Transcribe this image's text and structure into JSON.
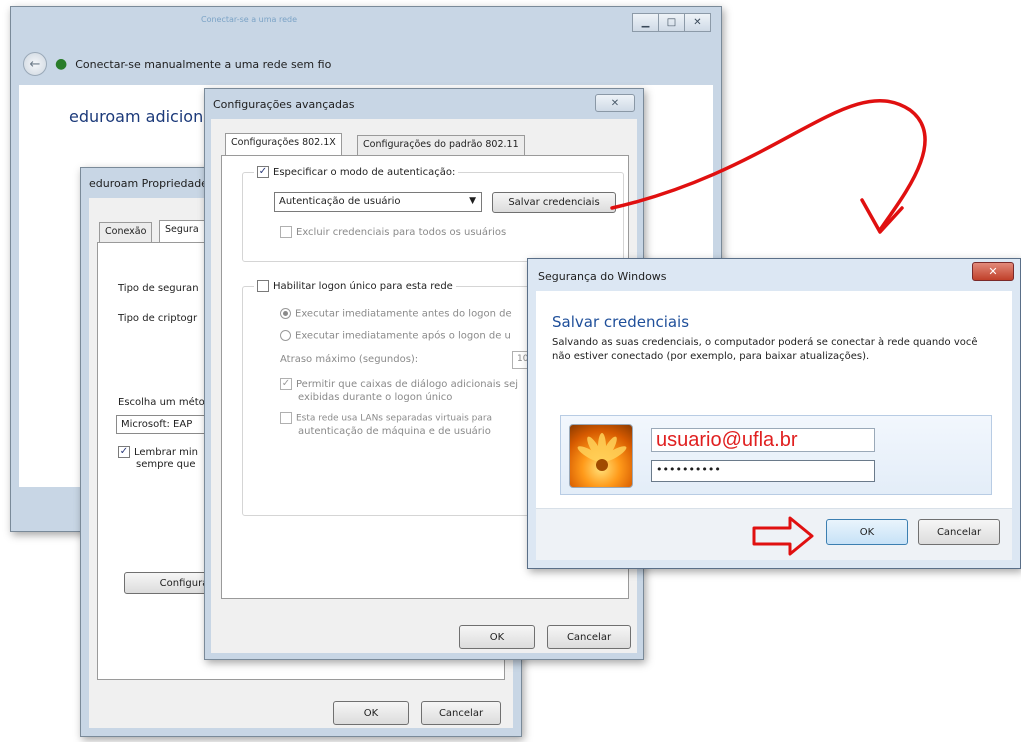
{
  "w1": {
    "title": "Conectar-se a uma rede",
    "nav_title": "Conectar-se manualmente a uma rede sem fio",
    "heading": "eduroam adiciona"
  },
  "w2": {
    "title": "eduroam Propriedades",
    "tabs": [
      "Conexão",
      "Segura"
    ],
    "labels": {
      "security_type": "Tipo de seguran",
      "encryption_type": "Tipo de criptogr",
      "choose_method": "Escolha um méto",
      "method_value": "Microsoft: EAP",
      "remember": "Lembrar min",
      "remember2": "sempre que",
      "configure": "Configura"
    },
    "ok": "OK",
    "cancel": "Cancelar"
  },
  "w3": {
    "title": "Configurações avançadas",
    "close": "✕",
    "tabs": [
      "Configurações 802.1X",
      "Configurações do padrão 802.11"
    ],
    "specify_auth": "Especificar o modo de autenticação:",
    "auth_mode": "Autenticação de usuário",
    "save_credentials": "Salvar credenciais",
    "delete_credentials": "Excluir credenciais para todos os usuários",
    "enable_sso": "Habilitar logon único para esta rede",
    "before_logon": "Executar imediatamente antes do logon de",
    "after_logon": "Executar imediatamente após o logon de u",
    "max_delay": "Atraso máximo (segundos):",
    "max_delay_value": "10",
    "allow_dialogs_1": "Permitir que caixas de diálogo adicionais sej",
    "allow_dialogs_2": "exibidas durante o logon único",
    "separate_lans_1": "Esta rede usa LANs separadas virtuais para",
    "separate_lans_2": "autenticação de máquina e de usuário",
    "ok": "OK",
    "cancel": "Cancelar"
  },
  "w4": {
    "title": "Segurança do Windows",
    "close": "✕",
    "heading": "Salvar credenciais",
    "desc": "Salvando as suas credenciais, o computador poderá se conectar à rede quando você não estiver conectado (por exemplo, para baixar atualizações).",
    "username": "usuario@ufla.br",
    "password": "••••••••••",
    "ok": "OK",
    "cancel": "Cancelar"
  },
  "colors": {
    "annotation_red": "#e01010",
    "heading_blue": "#1f4f9a"
  }
}
